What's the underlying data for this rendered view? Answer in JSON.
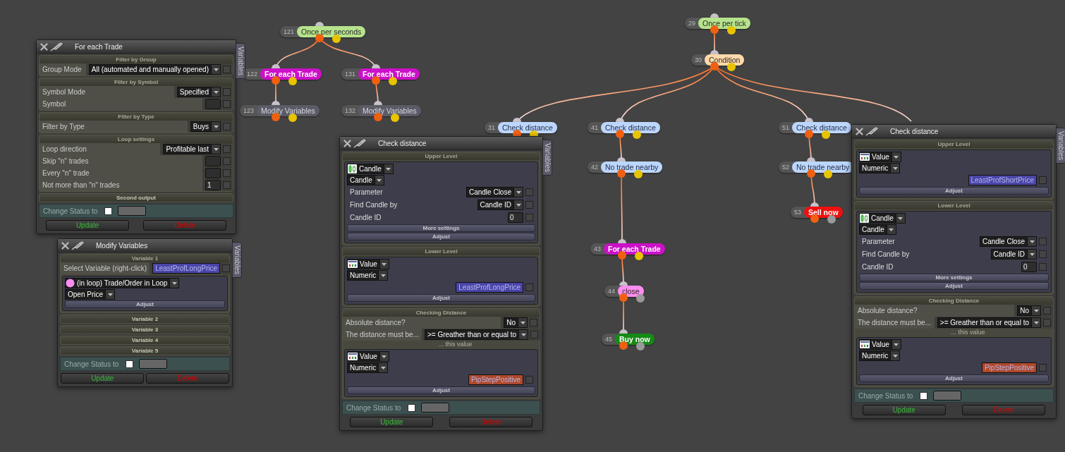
{
  "nodes": [
    {
      "number": "121",
      "label": "Once per seconds",
      "kind": "trigger"
    },
    {
      "number": "122",
      "label": "For each Trade",
      "kind": "loop"
    },
    {
      "number": "131",
      "label": "For each Trade",
      "kind": "loop"
    },
    {
      "number": "123",
      "label": "Modify Variables",
      "kind": "action"
    },
    {
      "number": "132",
      "label": "Modify Variables",
      "kind": "action"
    },
    {
      "number": "29",
      "label": "Once per tick",
      "kind": "trigger"
    },
    {
      "number": "30",
      "label": "Condition",
      "kind": "condition"
    },
    {
      "number": "31",
      "label": "Check distance",
      "kind": "check"
    },
    {
      "number": "41",
      "label": "Check distance",
      "kind": "check"
    },
    {
      "number": "51",
      "label": "Check distance",
      "kind": "check"
    },
    {
      "number": "42",
      "label": "No trade nearby",
      "kind": "check"
    },
    {
      "number": "52",
      "label": "No trade nearby",
      "kind": "check"
    },
    {
      "number": "43",
      "label": "For each Trade",
      "kind": "loop"
    },
    {
      "number": "44",
      "label": "close",
      "kind": "close"
    },
    {
      "number": "45",
      "label": "Buy now",
      "kind": "buy"
    },
    {
      "number": "53",
      "label": "Sell now",
      "kind": "sell"
    }
  ],
  "panels": [
    {
      "title": "For each Trade",
      "tab": "Variables",
      "sections": [
        {
          "title": "Filter by Group",
          "items": [
            {
              "kind": "select",
              "label": "Group Mode",
              "value": "All (automated and manually opened)",
              "checked": false
            }
          ]
        },
        {
          "title": "Filter by Symbol",
          "items": [
            {
              "kind": "select",
              "label": "Symbol Mode",
              "value": "Specified",
              "checked": false
            },
            {
              "kind": "input",
              "label": "Symbol",
              "checked": false
            }
          ]
        },
        {
          "title": "Filter by Type",
          "items": [
            {
              "kind": "select",
              "label": "Filter by Type",
              "value": "Buys",
              "checked": false
            }
          ]
        },
        {
          "title": "Loop settings",
          "items": [
            {
              "kind": "select",
              "label": "Loop direction",
              "value": "Profitable last",
              "checked": false
            },
            {
              "kind": "input",
              "label": "Skip \"n\" trades",
              "checked": false
            },
            {
              "kind": "input",
              "label": "Every \"n\" trade",
              "checked": false
            },
            {
              "kind": "input",
              "label": "Not more than \"n\" trades",
              "value": "1",
              "checked": false
            }
          ]
        },
        {
          "title": "Second output"
        }
      ],
      "status_label": "Change Status to",
      "status_checked": false,
      "buttons": [
        {
          "label": "Update",
          "kind": "update"
        },
        {
          "label": "Delete",
          "kind": "delete"
        }
      ]
    },
    {
      "title": "Modify Variables",
      "tab": "Variables",
      "sections": [
        {
          "title": "Variable 1",
          "items": [
            {
              "kind": "variable",
              "label": "Select Variable (right-click)",
              "value": "LeastProfLongPrice",
              "color": "#4a45a8",
              "checked": false
            },
            {
              "kind": "loop",
              "label": "(in loop) Trade/Order in Loop",
              "subtype": "Open Price",
              "buttons": [
                "Adjust"
              ]
            }
          ]
        },
        {
          "title": "Variable 2"
        },
        {
          "title": "Variable 3"
        },
        {
          "title": "Variable 4"
        },
        {
          "title": "Variable 5"
        }
      ],
      "status_label": "Change Status to",
      "status_checked": false,
      "buttons": [
        {
          "label": "Update",
          "kind": "update"
        },
        {
          "label": "Delete",
          "kind": "delete"
        }
      ]
    },
    {
      "title": "Check distance",
      "tab": "Variables",
      "sections": [
        {
          "title": "Upper Level",
          "items": [
            {
              "kind": "candle",
              "label": "Candle",
              "subtype": "Candle",
              "items": [
                {
                  "kind": "select",
                  "label": "Parameter",
                  "value": "Candle Close",
                  "checked": false
                },
                {
                  "kind": "select",
                  "label": "Find Candle by",
                  "value": "Candle ID",
                  "checked": false
                },
                {
                  "kind": "input",
                  "label": "Candle ID",
                  "value": "0",
                  "checked": false
                }
              ],
              "buttons": [
                "More settings",
                "Adjust"
              ]
            }
          ]
        },
        {
          "title": "Lower Level",
          "items": [
            {
              "kind": "value",
              "label": "Value",
              "subtype": "Numeric",
              "items": [
                {
                  "kind": "variable",
                  "value": "LeastProfLongPrice",
                  "color": "#4a45a8",
                  "checked": false
                }
              ],
              "buttons": [
                "Adjust"
              ]
            }
          ]
        },
        {
          "title": "Checking Distance",
          "items": [
            {
              "kind": "select",
              "label": "Absolute distance?",
              "value": "No",
              "checked": false
            },
            {
              "kind": "select",
              "label": "The distance must be...",
              "value": ">= Greather than or equal to",
              "checked": false
            },
            {
              "kind": "note",
              "text": "... this value"
            },
            {
              "kind": "value",
              "label": "Value",
              "subtype": "Numeric",
              "items": [
                {
                  "kind": "variable",
                  "value": "PipStepPositive",
                  "color": "#b0482a",
                  "checked": false
                }
              ],
              "buttons": [
                "Adjust"
              ]
            }
          ]
        }
      ],
      "status_label": "Change Status to",
      "status_checked": false,
      "buttons": [
        {
          "label": "Update",
          "kind": "update"
        },
        {
          "label": "Delete",
          "kind": "delete"
        }
      ]
    },
    {
      "title": "Check distance",
      "tab": "Variables",
      "sections": [
        {
          "title": "Upper Level",
          "items": [
            {
              "kind": "value",
              "label": "Value",
              "subtype": "Numeric",
              "items": [
                {
                  "kind": "variable",
                  "value": "LeastProfShortPrice",
                  "color": "#4a45a8",
                  "checked": false
                }
              ],
              "buttons": [
                "Adjust"
              ]
            }
          ]
        },
        {
          "title": "Lower Level",
          "items": [
            {
              "kind": "candle",
              "label": "Candle",
              "subtype": "Candle",
              "items": [
                {
                  "kind": "select",
                  "label": "Parameter",
                  "value": "Candle Close",
                  "checked": false
                },
                {
                  "kind": "select",
                  "label": "Find Candle by",
                  "value": "Candle ID",
                  "checked": false
                },
                {
                  "kind": "input",
                  "label": "Candle ID",
                  "value": "0",
                  "checked": false
                }
              ],
              "buttons": [
                "More settings",
                "Adjust"
              ]
            }
          ]
        },
        {
          "title": "Checking Distance",
          "items": [
            {
              "kind": "select",
              "label": "Absolute distance?",
              "value": "No",
              "checked": false
            },
            {
              "kind": "select",
              "label": "The distance must be...",
              "value": ">= Greather than or equal to",
              "checked": false
            },
            {
              "kind": "note",
              "text": "... this value"
            },
            {
              "kind": "value",
              "label": "Value",
              "subtype": "Numeric",
              "items": [
                {
                  "kind": "variable",
                  "value": "PipStepPositive",
                  "color": "#b0482a",
                  "checked": false
                }
              ],
              "buttons": [
                "Adjust"
              ]
            }
          ]
        }
      ],
      "status_label": "Change Status to",
      "status_checked": false,
      "buttons": [
        {
          "label": "Update",
          "kind": "update"
        },
        {
          "label": "Delete",
          "kind": "delete"
        }
      ]
    }
  ]
}
